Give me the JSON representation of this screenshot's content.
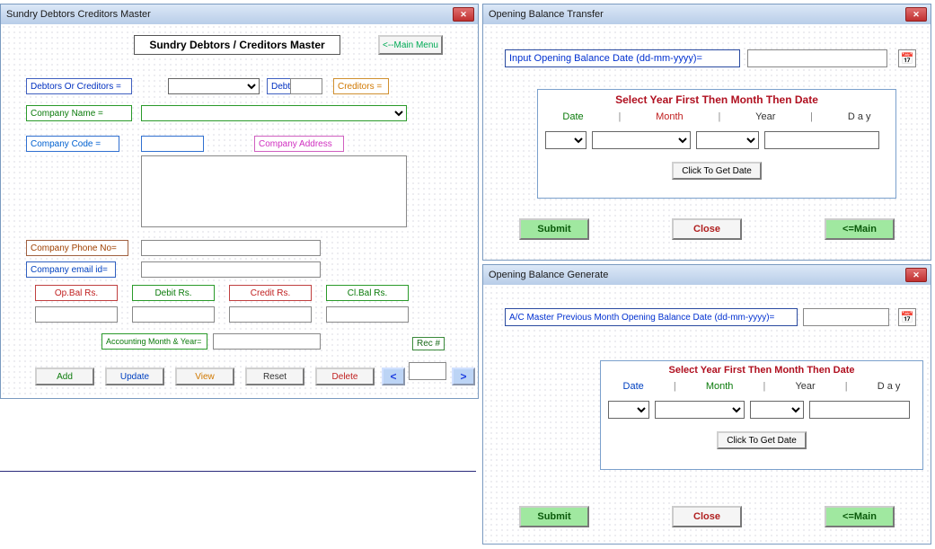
{
  "master": {
    "title_bar": "Sundry Debtors Creditors  Master",
    "heading": "Sundry Debtors / Creditors Master",
    "main_menu": "<--Main Menu",
    "labels": {
      "doc": "Debtors Or Creditors =",
      "debtors": "Debtors =",
      "creditors": "Creditors =",
      "company_name": "Company Name  =",
      "company_code": "Company Code   =",
      "company_address": "Company Address",
      "company_phone": "Company Phone No=",
      "company_email": "Company email id=",
      "acct_month": "Accounting Month & Year=",
      "rec": "Rec #"
    },
    "cols": {
      "opbal": "Op.Bal Rs.",
      "debit": "Debit Rs.",
      "credit": "Credit Rs.",
      "clbal": "Cl.Bal Rs."
    },
    "buttons": {
      "add": "Add",
      "update": "Update",
      "view": "View",
      "reset": "Reset",
      "delete": "Delete",
      "prev": "<",
      "next": ">"
    },
    "values": {
      "doc": "",
      "debtors": "",
      "creditors": "",
      "company_name": "",
      "company_code": "",
      "address": "",
      "phone": "",
      "email": "",
      "opbal": "",
      "debit": "",
      "credit": "",
      "clbal": "",
      "acct_month": "",
      "rec": ""
    }
  },
  "transfer": {
    "title_bar": "Opening Balance Transfer",
    "date_label": "Input Opening Balance Date (dd-mm-yyyy)=",
    "date_value": "",
    "panel_title": "Select Year First Then Month Then Date",
    "headers": {
      "date": "Date",
      "month": "Month",
      "year": "Year",
      "day": "D a y"
    },
    "click_get": "Click To Get Date",
    "submit": "Submit",
    "close": "Close",
    "main": "<=Main"
  },
  "generate": {
    "title_bar": "Opening Balance Generate",
    "date_label": "A/C Master Previous Month Opening Balance Date (dd-mm-yyyy)=",
    "date_value": "",
    "panel_title": "Select Year First Then Month Then Date",
    "headers": {
      "date": "Date",
      "month": "Month",
      "year": "Year",
      "day": "D a y"
    },
    "click_get": "Click To Get Date",
    "submit": "Submit",
    "close": "Close",
    "main": "<=Main"
  }
}
